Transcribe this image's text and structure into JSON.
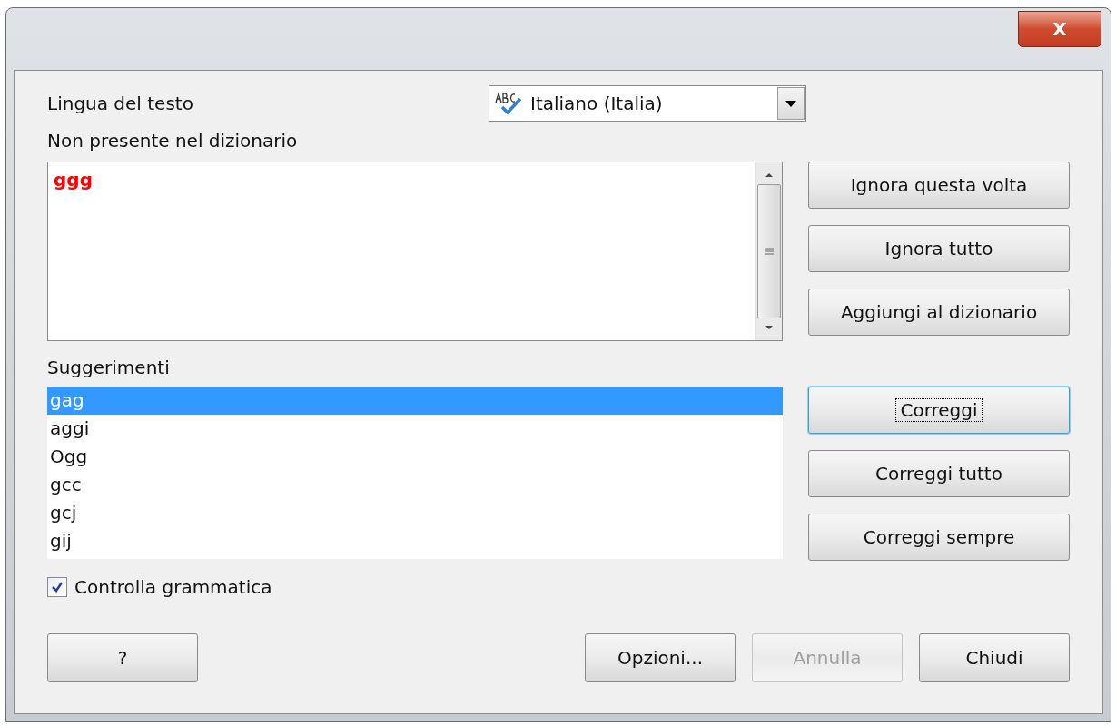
{
  "window": {
    "close_label": "X"
  },
  "language": {
    "label": "Lingua del testo",
    "value": "Italiano (Italia)"
  },
  "not_in_dictionary": {
    "label": "Non presente nel dizionario",
    "text": "ggg"
  },
  "side_buttons": [
    {
      "label": "Ignora questa volta",
      "focused": false
    },
    {
      "label": "Ignora tutto",
      "focused": false
    },
    {
      "label": "Aggiungi al dizionario",
      "focused": false
    }
  ],
  "suggestions": {
    "label": "Suggerimenti",
    "items": [
      {
        "text": "gag",
        "selected": true
      },
      {
        "text": "aggi",
        "selected": false
      },
      {
        "text": "Ogg",
        "selected": false
      },
      {
        "text": "gcc",
        "selected": false
      },
      {
        "text": "gcj",
        "selected": false
      },
      {
        "text": "gij",
        "selected": false
      }
    ]
  },
  "correct_buttons": [
    {
      "label": "Correggi",
      "focused": true
    },
    {
      "label": "Correggi tutto",
      "focused": false
    },
    {
      "label": "Correggi sempre",
      "focused": false
    }
  ],
  "grammar_check": {
    "label": "Controlla grammatica",
    "checked": true
  },
  "bottom_buttons": [
    {
      "label": "?",
      "disabled": false
    },
    {
      "label": "Opzioni...",
      "disabled": false
    },
    {
      "label": "Annulla",
      "disabled": true
    },
    {
      "label": "Chiudi",
      "disabled": false
    }
  ]
}
